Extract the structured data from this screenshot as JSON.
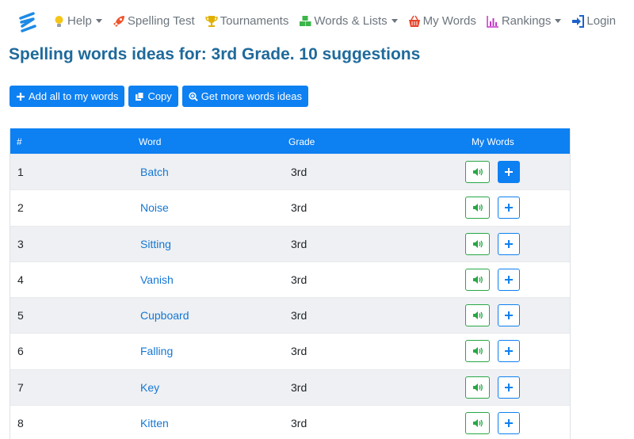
{
  "nav": {
    "items": [
      {
        "label": "Help",
        "icon": "lightbulb-icon",
        "color": "#f5c518",
        "caret": true
      },
      {
        "label": "Spelling Test",
        "icon": "rocket-icon",
        "color": "#f0542d",
        "caret": false
      },
      {
        "label": "Tournaments",
        "icon": "trophy-icon",
        "color": "#e0b000",
        "caret": false
      },
      {
        "label": "Words & Lists",
        "icon": "cubes-icon",
        "color": "#3cb54a",
        "caret": true
      },
      {
        "label": "My Words",
        "icon": "basket-icon",
        "color": "#e8452c",
        "caret": false
      },
      {
        "label": "Rankings",
        "icon": "bar-chart-icon",
        "color": "#c535c9",
        "caret": true
      },
      {
        "label": "Login",
        "icon": "sign-in-icon",
        "color": "#1e62c8",
        "caret": false
      }
    ]
  },
  "page": {
    "title": "Spelling words ideas for: 3rd Grade. 10 suggestions"
  },
  "actions": {
    "add_all": "Add all to my words",
    "copy": "Copy",
    "more": "Get more words ideas"
  },
  "table": {
    "headers": {
      "num": "#",
      "word": "Word",
      "grade": "Grade",
      "my_words": "My Words"
    },
    "rows": [
      {
        "num": "1",
        "word": "Batch",
        "grade": "3rd",
        "added": true
      },
      {
        "num": "2",
        "word": "Noise",
        "grade": "3rd",
        "added": false
      },
      {
        "num": "3",
        "word": "Sitting",
        "grade": "3rd",
        "added": false
      },
      {
        "num": "4",
        "word": "Vanish",
        "grade": "3rd",
        "added": false
      },
      {
        "num": "5",
        "word": "Cupboard",
        "grade": "3rd",
        "added": false
      },
      {
        "num": "6",
        "word": "Falling",
        "grade": "3rd",
        "added": false
      },
      {
        "num": "7",
        "word": "Key",
        "grade": "3rd",
        "added": false
      },
      {
        "num": "8",
        "word": "Kitten",
        "grade": "3rd",
        "added": false
      }
    ]
  },
  "colors": {
    "accent": "#0d80f2",
    "title": "#1f6a9b",
    "sound": "#28a745",
    "link": "#1577d3"
  }
}
